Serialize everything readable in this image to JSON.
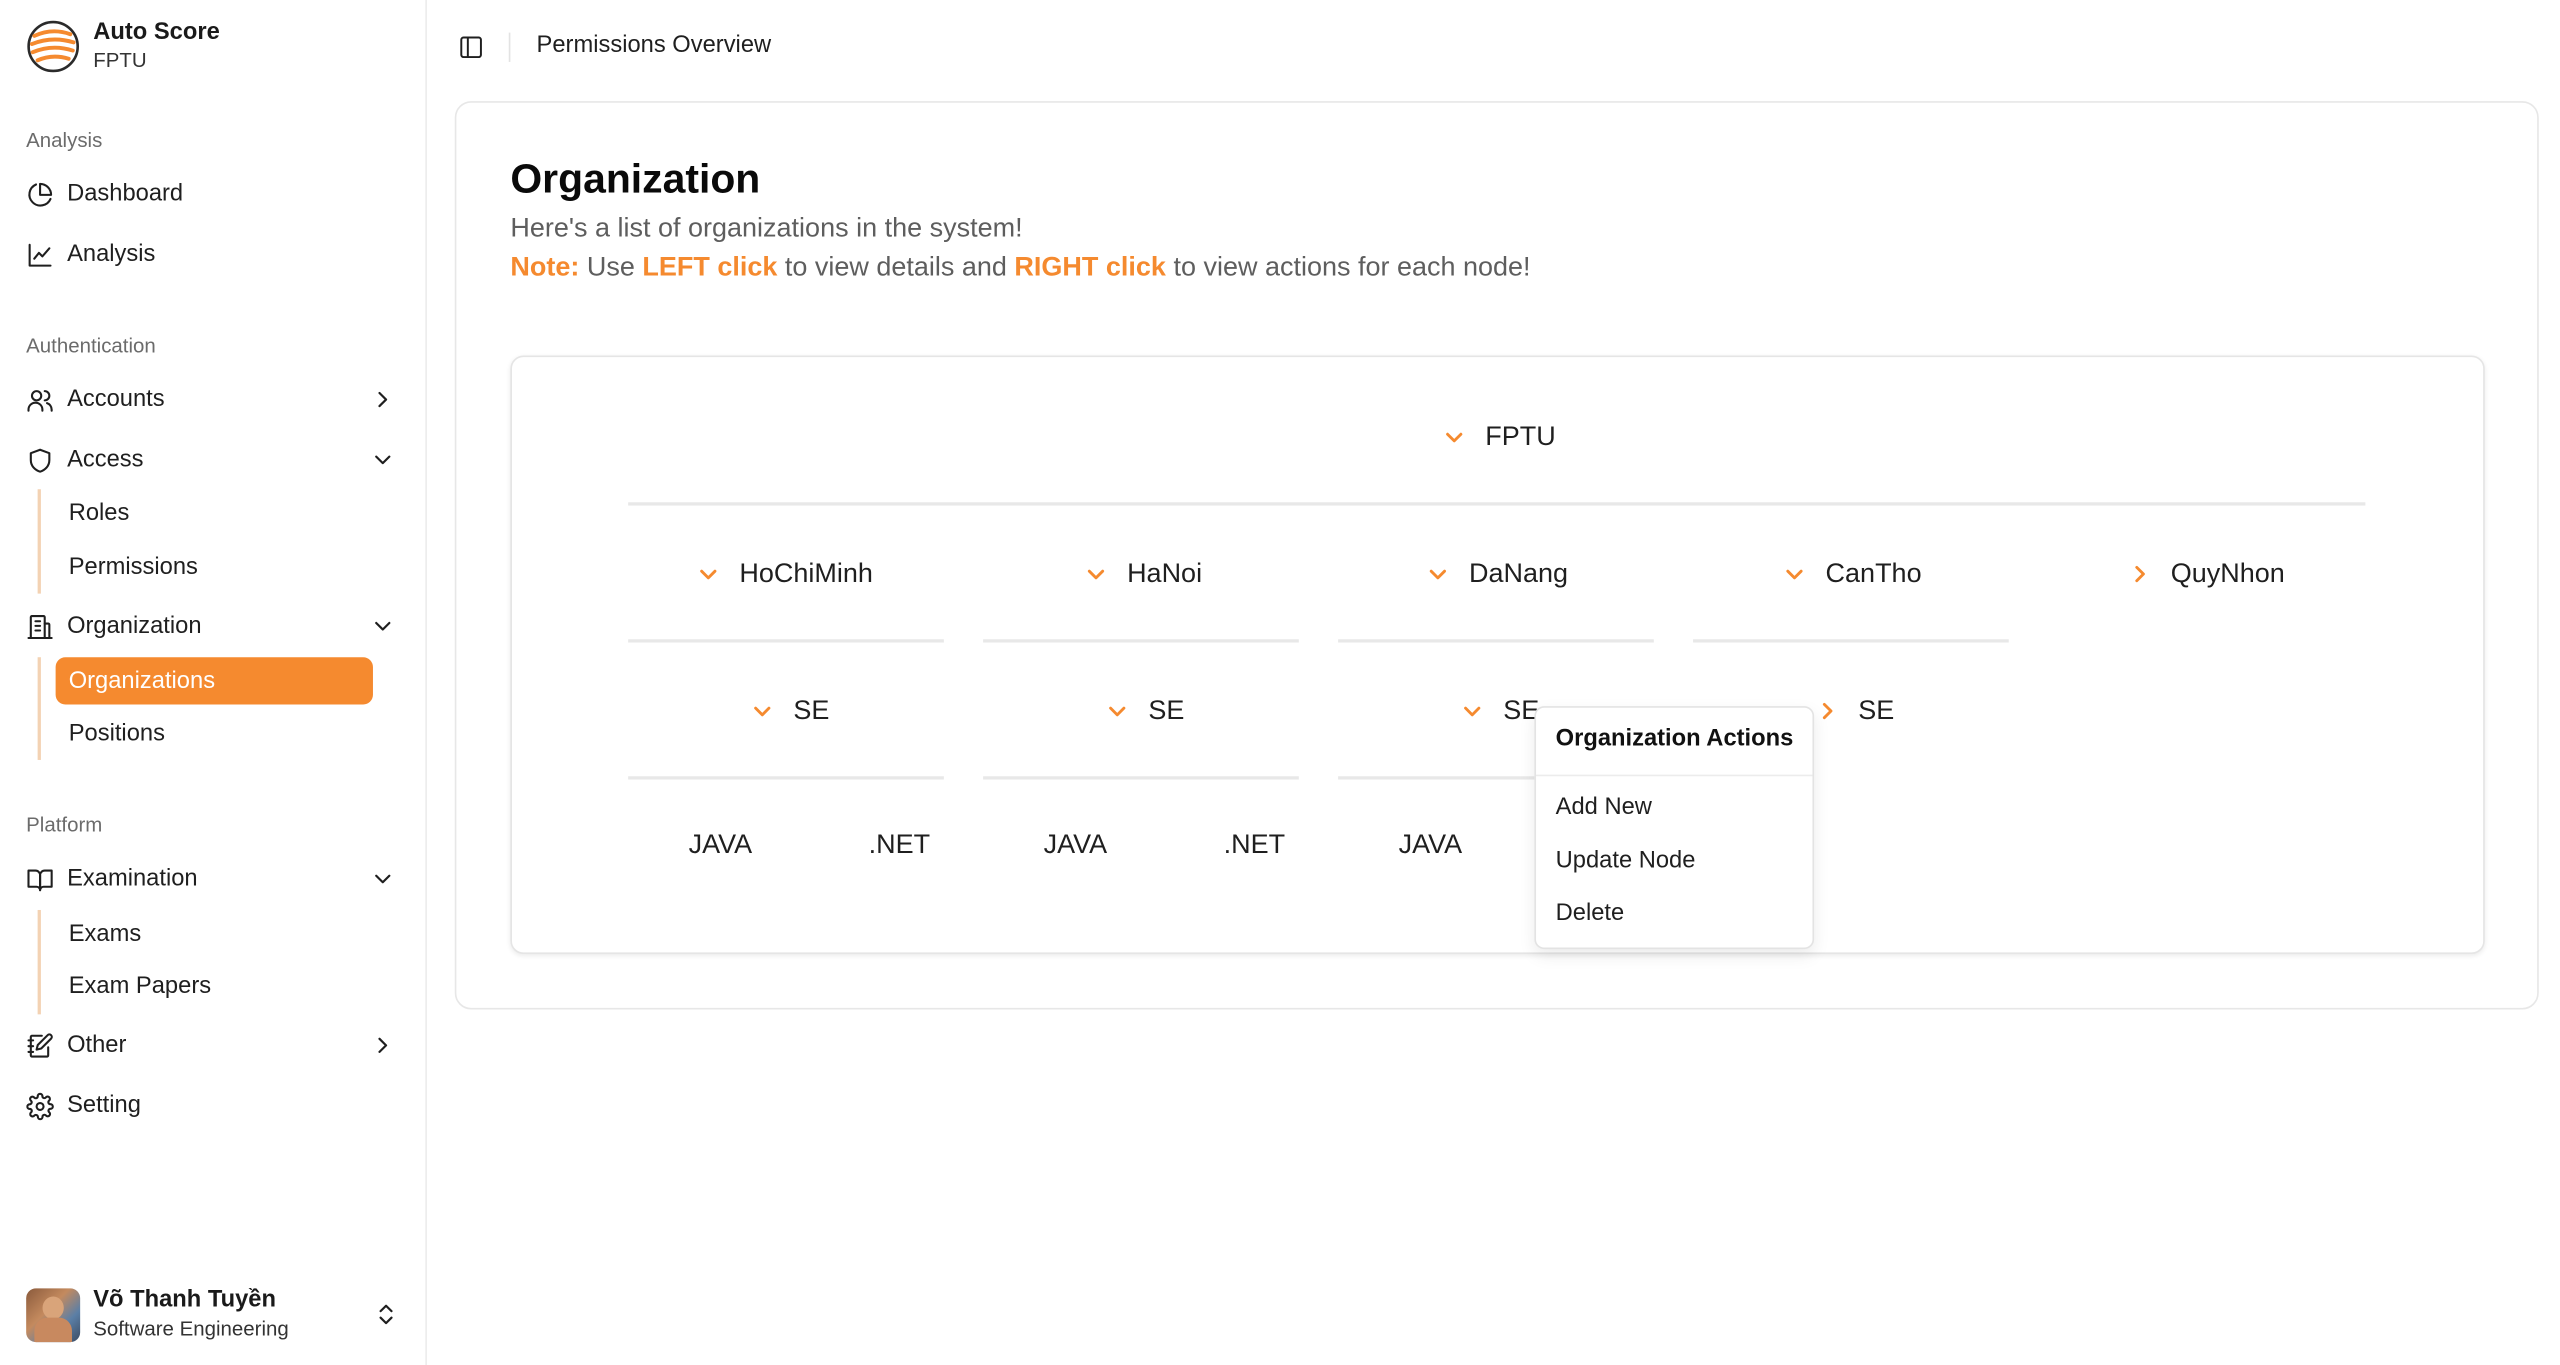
{
  "colors": {
    "accent": "#f58a2f",
    "accent_light": "#f3d2b3"
  },
  "brand": {
    "title": "Auto Score",
    "subtitle": "FPTU",
    "icon": "logo-icon"
  },
  "sidebar": {
    "sections": [
      {
        "label": "Analysis"
      },
      {
        "label": "Authentication"
      },
      {
        "label": "Platform"
      }
    ],
    "items": {
      "dashboard": {
        "label": "Dashboard",
        "icon": "pie-chart-icon"
      },
      "analysis": {
        "label": "Analysis",
        "icon": "line-chart-icon"
      },
      "accounts": {
        "label": "Accounts",
        "icon": "users-icon"
      },
      "access": {
        "label": "Access",
        "icon": "shield-icon"
      },
      "roles": {
        "label": "Roles"
      },
      "permissions": {
        "label": "Permissions"
      },
      "organization": {
        "label": "Organization",
        "icon": "building-icon"
      },
      "organizations": {
        "label": "Organizations"
      },
      "positions": {
        "label": "Positions"
      },
      "examination": {
        "label": "Examination",
        "icon": "book-icon"
      },
      "exams": {
        "label": "Exams"
      },
      "exam_papers": {
        "label": "Exam Papers"
      },
      "other": {
        "label": "Other",
        "icon": "notebook-pen-icon"
      },
      "setting": {
        "label": "Setting",
        "icon": "gear-icon"
      }
    }
  },
  "user": {
    "name": "Võ Thanh Tuyền",
    "role": "Software Engineering"
  },
  "topbar": {
    "breadcrumb": "Permissions Overview"
  },
  "page": {
    "title": "Organization",
    "description": "Here's a list of organizations in the system!",
    "note_label": "Note:",
    "note_text_1": " Use ",
    "note_left": "LEFT click",
    "note_text_2": " to view details and ",
    "note_right": "RIGHT click",
    "note_text_3": " to view actions for each node!"
  },
  "tree": {
    "root": "FPTU",
    "campuses": [
      "HoChiMinh",
      "HaNoi",
      "DaNang",
      "CanTho",
      "QuyNhon"
    ],
    "departments": [
      "SE",
      "SE",
      "SE",
      "SE"
    ],
    "leaves": [
      "JAVA",
      ".NET",
      "JAVA",
      ".NET",
      "JAVA"
    ]
  },
  "context_menu": {
    "title": "Organization Actions",
    "items": [
      "Add New",
      "Update Node",
      "Delete"
    ]
  }
}
